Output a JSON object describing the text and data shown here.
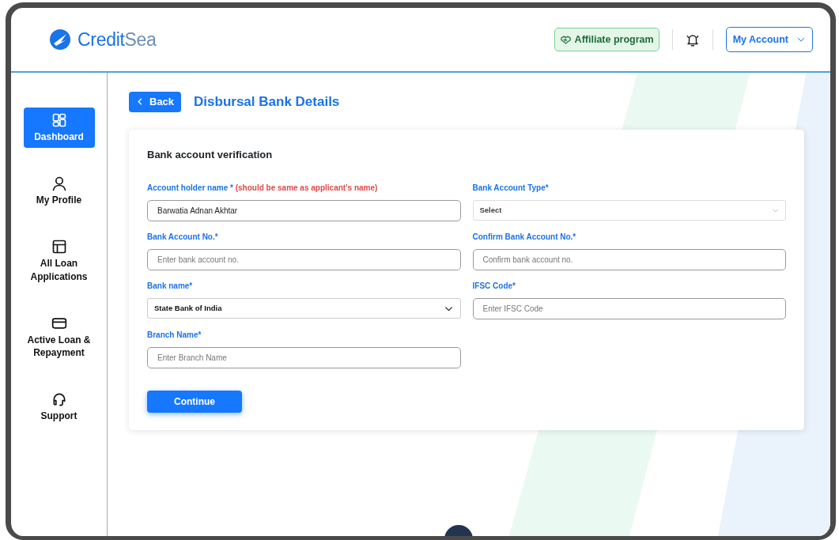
{
  "header": {
    "brand": [
      "Credit",
      "Sea"
    ],
    "affiliate": "Affiliate program",
    "account": "My Account"
  },
  "sidebar": {
    "items": [
      {
        "label": "Dashboard",
        "selected": true
      },
      {
        "label": "My Profile",
        "selected": false
      },
      {
        "label": "All Loan Applications",
        "selected": false
      },
      {
        "label": "Active Loan & Repayment",
        "selected": false
      },
      {
        "label": "Support",
        "selected": false
      }
    ]
  },
  "page": {
    "back": "Back",
    "title": "Disbursal Bank Details"
  },
  "form": {
    "title": "Bank account verification",
    "fields": [
      {
        "label": "Account holder name *",
        "note": "(should be same as applicant's name)",
        "kind": "input",
        "value": "Barwatia Adnan Akhtar"
      },
      {
        "label": "Bank Account Type*",
        "kind": "select",
        "placeholder": "Select"
      },
      {
        "label": "Bank Account No.*",
        "kind": "input",
        "placeholder": "Enter bank account no."
      },
      {
        "label": "Confirm Bank Account No.*",
        "kind": "input",
        "placeholder": "Confirm bank account no."
      },
      {
        "label": "Bank name*",
        "kind": "select",
        "value": "State Bank of India"
      },
      {
        "label": "IFSC Code*",
        "kind": "input",
        "placeholder": "Enter IFSC Code"
      },
      {
        "label": "Branch Name*",
        "kind": "input",
        "placeholder": "Enter Branch Name"
      }
    ],
    "submit": "Continue"
  }
}
